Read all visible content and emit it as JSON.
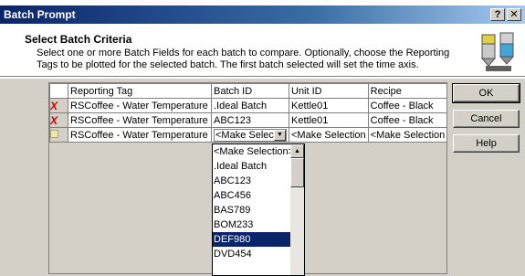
{
  "window": {
    "title": "Batch Prompt",
    "help_glyph": "?",
    "close_glyph": "✕"
  },
  "header": {
    "title": "Select Batch Criteria",
    "description": "Select one or more Batch Fields for each batch to compare.  Optionally, choose the Reporting Tags to be plotted for the selected batch.  The first batch selected will set the time axis."
  },
  "grid": {
    "columns": [
      "Reporting Tag",
      "Batch ID",
      "Unit ID",
      "Recipe"
    ],
    "rows": [
      {
        "mark": "X",
        "tag": "RSCoffee - Water Temperature",
        "batch": ".Ideal Batch",
        "unit": "Kettle01",
        "recipe": "Coffee - Black"
      },
      {
        "mark": "X",
        "tag": "RSCoffee - Water Temperature",
        "batch": "ABC123",
        "unit": "Kettle01",
        "recipe": "Coffee - Black"
      },
      {
        "mark": "",
        "tag": "RSCoffee - Water Temperature",
        "batch": "<Make Select",
        "unit": "<Make Selection",
        "recipe": "<Make Selection"
      }
    ]
  },
  "dropdown": {
    "items": [
      "<Make Selection>",
      ".Ideal Batch",
      "ABC123",
      "ABC456",
      "BAS789",
      "BOM233",
      "DEF980",
      "DVD454"
    ],
    "selected": "DEF980"
  },
  "buttons": {
    "ok": "OK",
    "cancel": "Cancel",
    "help": "Help"
  },
  "colors": {
    "title_bar": "#0a246a",
    "selection": "#0a246a",
    "delete_mark": "#d00000",
    "dialog_face": "#d4d0c8"
  }
}
